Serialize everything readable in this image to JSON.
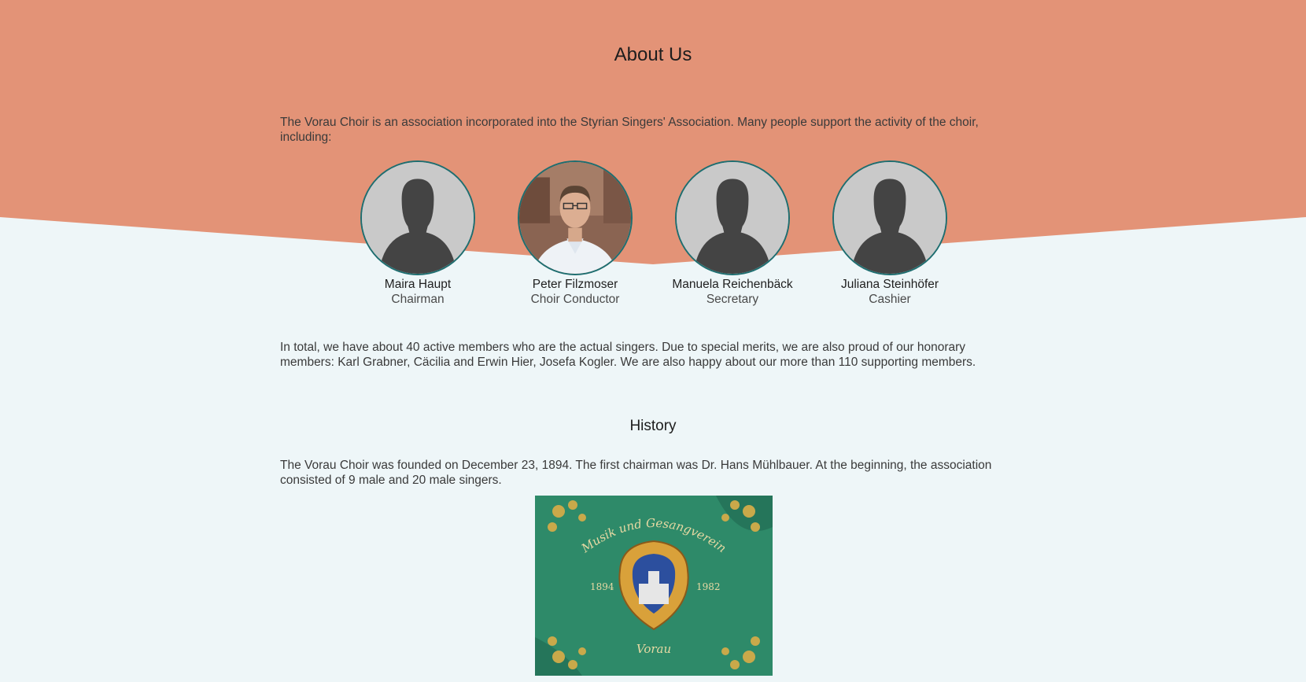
{
  "page": {
    "title": "About Us",
    "intro": "The Vorau Choir is an association incorporated into the Styrian Singers' Association. Many people support the activity of the choir, including:",
    "members": [
      {
        "name": "Maira Haupt",
        "role": "Chairman"
      },
      {
        "name": "Peter Filzmoser",
        "role": "Choir Conductor"
      },
      {
        "name": "Manuela Reichenbäck",
        "role": "Secretary"
      },
      {
        "name": "Juliana Steinhöfer",
        "role": "Cashier"
      }
    ],
    "total": "In total, we have about 40 active members who are the actual singers. Due to special merits, we are also proud of our honorary members: Karl Grabner, Cäcilia and Erwin Hier, Josefa Kogler. We are also happy about our more than 110 supporting members.",
    "history_title": "History",
    "history_text": "The Vorau Choir was founded on December 23, 1894. The first chairman was Dr. Hans Mühlbauer. At the beginning, the association consisted of 9 male and 20 male singers.",
    "flag": {
      "inscription": "Musik und Gesangverein",
      "year_left": "1894",
      "year_right": "1982",
      "bottom": "Vorau"
    }
  },
  "colors": {
    "salmon": "#e39377",
    "background": "#eef6f8",
    "avatar_border": "#1e6e70"
  },
  "icons": [
    "person-silhouette-icon"
  ]
}
